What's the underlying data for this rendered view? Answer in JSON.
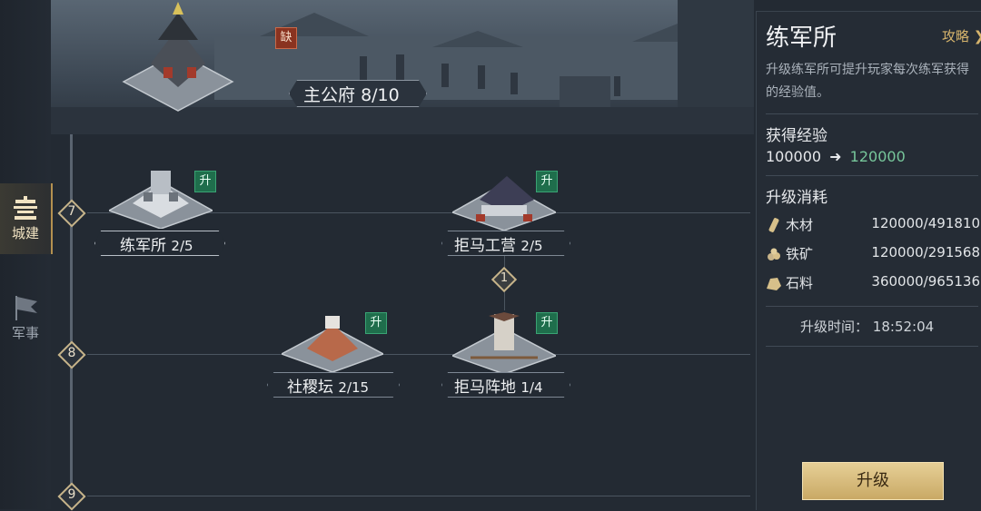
{
  "sidebar": {
    "tabs": [
      {
        "label": "城建",
        "active": true,
        "icon": "city-icon"
      },
      {
        "label": "军事",
        "active": false,
        "icon": "flag-icon"
      }
    ]
  },
  "header": {
    "building": "主公府",
    "level": "8/10",
    "badge": "缺"
  },
  "tree": {
    "levels": [
      "7",
      "8",
      "9"
    ],
    "connector": "1",
    "buildings": [
      {
        "name": "练军所",
        "level": "2/5",
        "badge": "升"
      },
      {
        "name": "拒马工营",
        "level": "2/5",
        "badge": "升"
      },
      {
        "name": "社稷坛",
        "level": "2/15",
        "badge": "升"
      },
      {
        "name": "拒马阵地",
        "level": "1/4",
        "badge": "升"
      }
    ]
  },
  "panel": {
    "title": "练军所",
    "guide": "攻略",
    "description": "升级练军所可提升玩家每次练军获得的经验值。",
    "exp_header": "获得经验",
    "exp_from": "100000",
    "exp_arrow": "➜",
    "exp_to": "120000",
    "cost_header": "升级消耗",
    "resources": [
      {
        "name": "木材",
        "value": "120000/491810",
        "icon": "wood-icon"
      },
      {
        "name": "铁矿",
        "value": "120000/291568",
        "icon": "iron-icon"
      },
      {
        "name": "石料",
        "value": "360000/965136",
        "icon": "stone-icon"
      }
    ],
    "time_label": "升级时间：",
    "time_value": "18:52:04",
    "upgrade_button": "升级"
  },
  "colors": {
    "gold": "#c9a965",
    "green_value": "#77c79b",
    "upgrade_badge": "#1f6e4c",
    "missing_badge": "#8a3320"
  }
}
